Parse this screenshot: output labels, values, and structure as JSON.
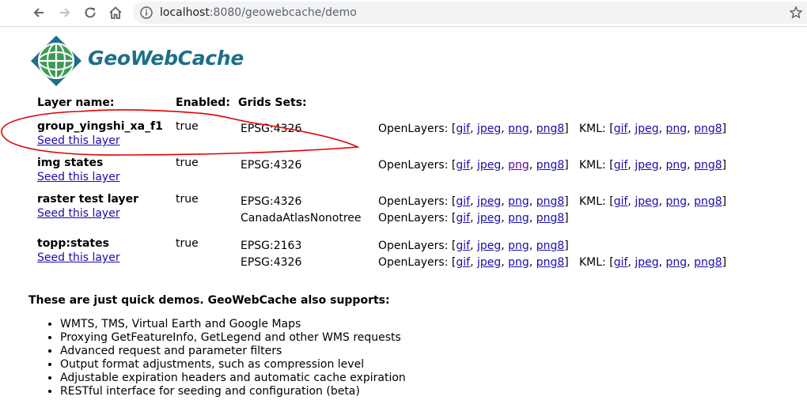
{
  "browser": {
    "url_host": "localhost",
    "url_path": ":8080/geowebcache/demo"
  },
  "logo": {
    "text": "GeoWebCache"
  },
  "table": {
    "headers": {
      "layer_name": "Layer name:",
      "enabled": "Enabled:",
      "grid_sets": "Grids Sets:"
    },
    "seed_label": "Seed this layer",
    "openlayers_label": "OpenLayers:",
    "kml_label": "KML:",
    "formats": [
      "gif",
      "jpeg",
      "png",
      "png8"
    ],
    "layers": [
      {
        "name": "group_yingshi_xa_f1",
        "enabled": "true",
        "grids": [
          {
            "name": "EPSG:4326",
            "kml": true
          }
        ]
      },
      {
        "name": "img states",
        "enabled": "true",
        "grids": [
          {
            "name": "EPSG:4326",
            "kml": true
          }
        ]
      },
      {
        "name": "raster test layer",
        "enabled": "true",
        "grids": [
          {
            "name": "EPSG:4326",
            "kml": true
          },
          {
            "name": "CanadaAtlasNonotree",
            "kml": false
          }
        ]
      },
      {
        "name": "topp:states",
        "enabled": "true",
        "grids": [
          {
            "name": "EPSG:2163",
            "kml": false
          },
          {
            "name": "EPSG:4326",
            "kml": true
          }
        ]
      }
    ]
  },
  "supports": {
    "title": "These are just quick demos. GeoWebCache also supports:",
    "items": [
      "WMTS, TMS, Virtual Earth and Google Maps",
      "Proxying GetFeatureInfo, GetLegend and other WMS requests",
      "Advanced request and parameter filters",
      "Output format adjustments, such as compression level",
      "Adjustable expiration headers and automatic cache expiration",
      "RESTful interface for seeding and configuration (beta)"
    ]
  },
  "colors": {
    "link": "#1a0dab",
    "visited_link": "#660099",
    "annotation": "#e00000",
    "logo_text": "#1d6f8a"
  }
}
